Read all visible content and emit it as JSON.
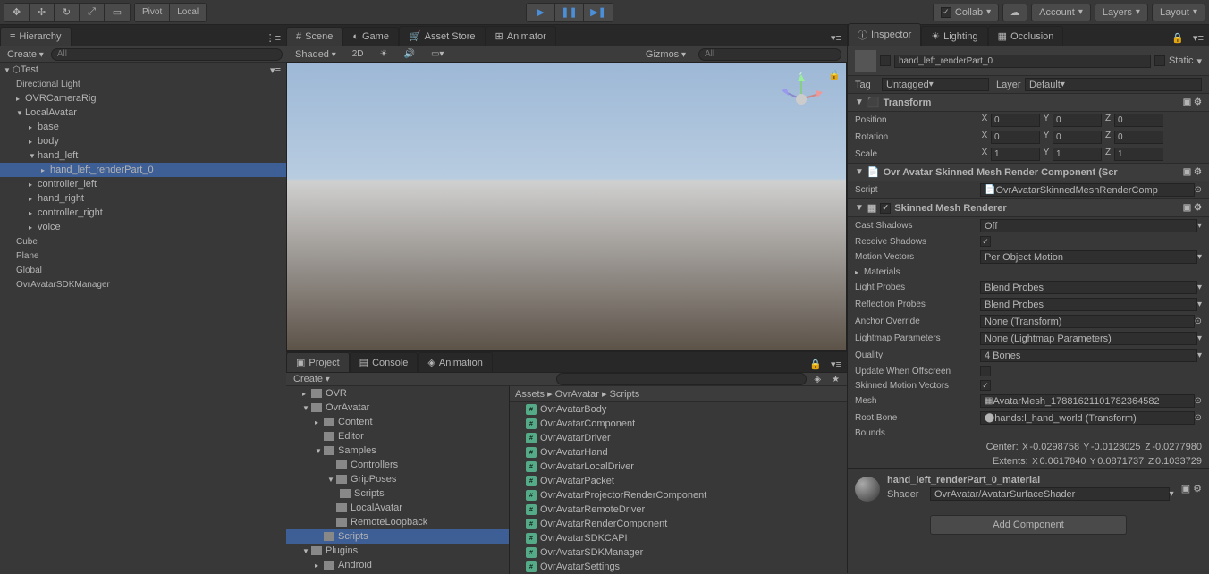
{
  "toolbar": {
    "pivot": "Pivot",
    "local": "Local",
    "collab": "Collab",
    "account": "Account",
    "layers": "Layers",
    "layout": "Layout"
  },
  "hierarchy": {
    "tab": "Hierarchy",
    "create": "Create",
    "search_placeholder": "All",
    "scene_name": "Test",
    "items": [
      "Directional Light",
      "OVRCameraRig",
      "LocalAvatar",
      "base",
      "body",
      "hand_left",
      "hand_left_renderPart_0",
      "controller_left",
      "hand_right",
      "controller_right",
      "voice",
      "Cube",
      "Plane",
      "Global",
      "OvrAvatarSDKManager"
    ]
  },
  "scene_tabs": {
    "scene": "Scene",
    "game": "Game",
    "asset_store": "Asset Store",
    "animator": "Animator"
  },
  "scene_toolbar": {
    "shaded": "Shaded",
    "two_d": "2D",
    "gizmos": "Gizmos",
    "search_placeholder": "All"
  },
  "project": {
    "tab": "Project",
    "console": "Console",
    "animation": "Animation",
    "create": "Create",
    "folders": [
      "OVR",
      "OvrAvatar",
      "Content",
      "Editor",
      "Samples",
      "Controllers",
      "GripPoses",
      "Scripts",
      "LocalAvatar",
      "RemoteLoopback",
      "Scripts",
      "Plugins",
      "Android"
    ],
    "breadcrumb": "Assets ▸ OvrAvatar ▸ Scripts",
    "files": [
      "OvrAvatarBody",
      "OvrAvatarComponent",
      "OvrAvatarDriver",
      "OvrAvatarHand",
      "OvrAvatarLocalDriver",
      "OvrAvatarPacket",
      "OvrAvatarProjectorRenderComponent",
      "OvrAvatarRemoteDriver",
      "OvrAvatarRenderComponent",
      "OvrAvatarSDKCAPI",
      "OvrAvatarSDKManager",
      "OvrAvatarSettings"
    ]
  },
  "inspector": {
    "tab": "Inspector",
    "lighting": "Lighting",
    "occlusion": "Occlusion",
    "object_name": "hand_left_renderPart_0",
    "static": "Static",
    "tag_label": "Tag",
    "tag_value": "Untagged",
    "layer_label": "Layer",
    "layer_value": "Default",
    "transform": {
      "title": "Transform",
      "position": "Position",
      "rotation": "Rotation",
      "scale": "Scale",
      "pos": {
        "x": "0",
        "y": "0",
        "z": "0"
      },
      "rot": {
        "x": "0",
        "y": "0",
        "z": "0"
      },
      "scl": {
        "x": "1",
        "y": "1",
        "z": "1"
      }
    },
    "avatar_component": {
      "title": "Ovr Avatar Skinned Mesh Render Component (Scr",
      "script_label": "Script",
      "script_value": "OvrAvatarSkinnedMeshRenderComp"
    },
    "smr": {
      "title": "Skinned Mesh Renderer",
      "cast_shadows": "Cast Shadows",
      "cast_shadows_value": "Off",
      "receive_shadows": "Receive Shadows",
      "motion_vectors": "Motion Vectors",
      "motion_vectors_value": "Per Object Motion",
      "materials": "Materials",
      "light_probes": "Light Probes",
      "light_probes_value": "Blend Probes",
      "reflection_probes": "Reflection Probes",
      "reflection_probes_value": "Blend Probes",
      "anchor_override": "Anchor Override",
      "anchor_override_value": "None (Transform)",
      "lightmap_params": "Lightmap Parameters",
      "lightmap_params_value": "None (Lightmap Parameters)",
      "quality": "Quality",
      "quality_value": "4 Bones",
      "update_offscreen": "Update When Offscreen",
      "skinned_motion": "Skinned Motion Vectors",
      "mesh": "Mesh",
      "mesh_value": "AvatarMesh_17881621101782364582",
      "root_bone": "Root Bone",
      "root_bone_value": "hands:l_hand_world (Transform)",
      "bounds": "Bounds",
      "center_label": "Center:",
      "center": {
        "x": "-0.0298758",
        "y": "-0.0128025",
        "z": "-0.0277980"
      },
      "extents_label": "Extents:",
      "extents": {
        "x": "0.0617840",
        "y": "0.0871737",
        "z": "0.1033729"
      }
    },
    "material": {
      "name": "hand_left_renderPart_0_material",
      "shader_label": "Shader",
      "shader_value": "OvrAvatar/AvatarSurfaceShader"
    },
    "add_component": "Add Component"
  }
}
